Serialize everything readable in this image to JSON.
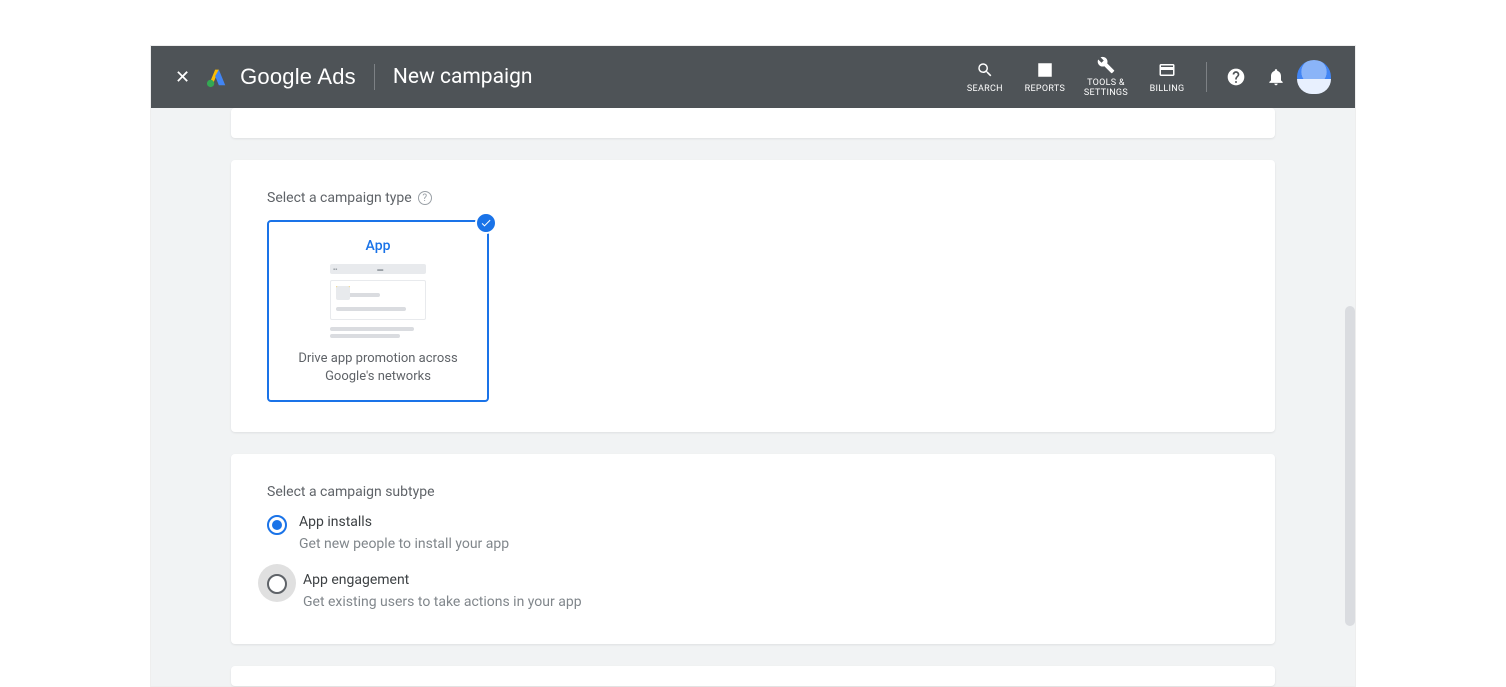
{
  "header": {
    "brand": "Google Ads",
    "page_title": "New campaign",
    "buttons": {
      "search": "SEARCH",
      "reports": "REPORTS",
      "tools": "TOOLS &\nSETTINGS",
      "billing": "BILLING"
    }
  },
  "campaign_type": {
    "label": "Select a campaign type",
    "tile": {
      "title": "App",
      "description": "Drive app promotion across Google's networks"
    }
  },
  "subtype": {
    "label": "Select a campaign subtype",
    "options": [
      {
        "title": "App installs",
        "description": "Get new people to install your app",
        "selected": true
      },
      {
        "title": "App engagement",
        "description": "Get existing users to take actions in your app",
        "selected": false
      }
    ]
  }
}
